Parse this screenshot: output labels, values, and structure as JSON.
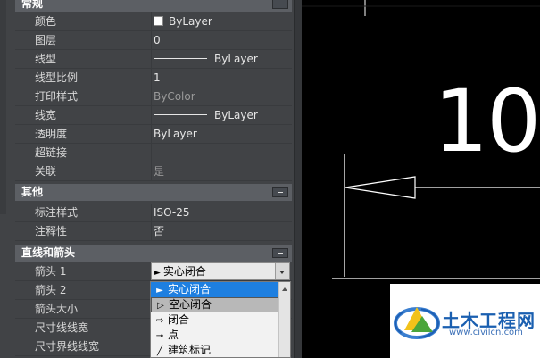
{
  "sections": {
    "general": "常规",
    "other": "其他",
    "lines_arrows": "直线和箭头"
  },
  "general_rows": [
    {
      "label": "颜色",
      "value": "ByLayer"
    },
    {
      "label": "图层",
      "value": "0"
    },
    {
      "label": "线型",
      "value": "ByLayer"
    },
    {
      "label": "线型比例",
      "value": "1"
    },
    {
      "label": "打印样式",
      "value": "ByColor"
    },
    {
      "label": "线宽",
      "value": "ByLayer"
    },
    {
      "label": "透明度",
      "value": "ByLayer"
    },
    {
      "label": "超链接",
      "value": ""
    },
    {
      "label": "关联",
      "value": "是"
    }
  ],
  "other_rows": [
    {
      "label": "标注样式",
      "value": "ISO-25"
    },
    {
      "label": "注释性",
      "value": "否"
    }
  ],
  "lines_rows": [
    {
      "label": "箭头 1",
      "value": "实心闭合"
    },
    {
      "label": "箭头 2",
      "value": ""
    },
    {
      "label": "箭头大小",
      "value": ""
    },
    {
      "label": "尺寸线线宽",
      "value": ""
    },
    {
      "label": "尺寸界线线宽",
      "value": ""
    }
  ],
  "dropdown_options": [
    {
      "label": "实心闭合",
      "icon": "solid-arrow-icon",
      "state": "selected"
    },
    {
      "label": "空心闭合",
      "icon": "hollow-arrow-icon",
      "state": "hover"
    },
    {
      "label": "闭合",
      "icon": "closed-arrow-icon",
      "state": ""
    },
    {
      "label": "点",
      "icon": "dot-icon",
      "state": ""
    },
    {
      "label": "建筑标记",
      "icon": "arch-tick-icon",
      "state": ""
    }
  ],
  "canvas": {
    "dimension_text": "10",
    "background": "#000000",
    "line_color": "#ffffff"
  },
  "watermark": {
    "title": "土木工程网",
    "url": "www.civilcn.com"
  },
  "colors": {
    "panel": "#414346",
    "section_header": "#5c5f64",
    "selection": "#1e7fe0"
  }
}
